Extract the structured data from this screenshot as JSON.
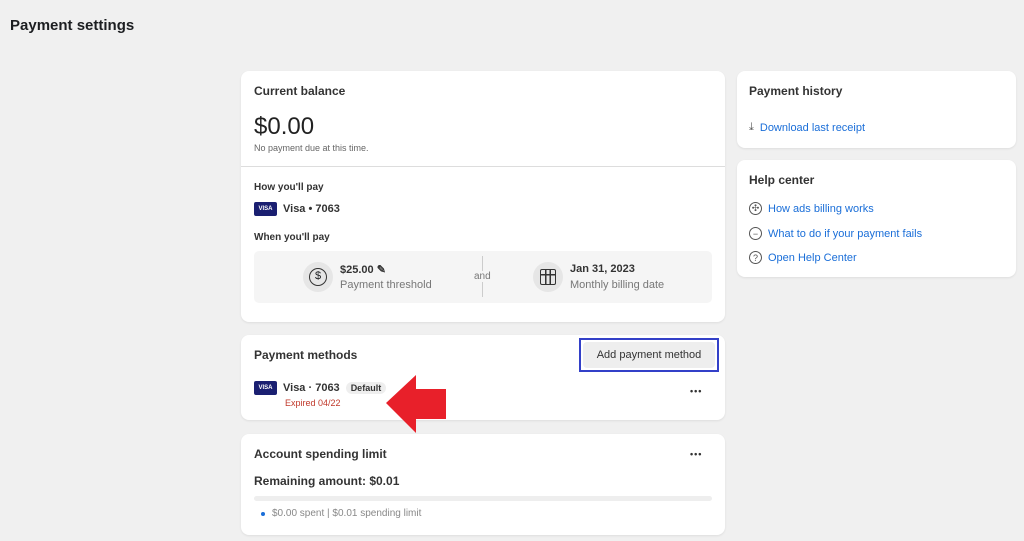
{
  "page_title": "Payment settings",
  "balance": {
    "title": "Current balance",
    "amount": "$0.00",
    "note": "No payment due at this time.",
    "how_title": "How you'll pay",
    "card_brand": "VISA",
    "card": "Visa • 7063",
    "when_title": "When you'll pay",
    "threshold_value": "$25.00",
    "threshold_label": "Payment threshold",
    "and": "and",
    "billing_date": "Jan 31, 2023",
    "billing_label": "Monthly billing date"
  },
  "methods": {
    "title": "Payment methods",
    "add_button": "Add payment method",
    "card_brand": "VISA",
    "card": "Visa · 7063",
    "badge": "Default",
    "expired": "Expired 04/22",
    "more": "•••"
  },
  "spending": {
    "title": "Account spending limit",
    "more": "•••",
    "remaining": "Remaining amount: $0.01",
    "progress_percent": 0,
    "detail": "$0.00 spent | $0.01 spending limit"
  },
  "history": {
    "title": "Payment history",
    "download": "Download last receipt"
  },
  "help": {
    "title": "Help center",
    "items": [
      {
        "label": "How ads billing works",
        "icon": "billing-icon"
      },
      {
        "label": "What to do if your payment fails",
        "icon": "minus-circle-icon"
      },
      {
        "label": "Open Help Center",
        "icon": "question-icon"
      }
    ]
  },
  "colors": {
    "link": "#1a6ed8",
    "expired": "#c0392b",
    "highlight": "#3340c8",
    "arrow": "#e8202a",
    "visa": "#1a1f71"
  }
}
